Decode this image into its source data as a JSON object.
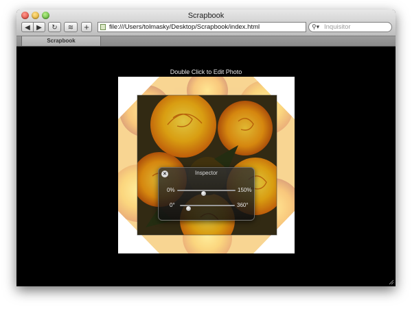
{
  "window": {
    "title": "Scrapbook",
    "traffic_lights": [
      "close",
      "minimize",
      "zoom"
    ]
  },
  "toolbar": {
    "back_icon": "◀",
    "forward_icon": "▶",
    "reload_icon": "↻",
    "snippet_icon": "≋",
    "add_icon": "+",
    "url": "file:///Users/tolmasky/Desktop/Scrapbook/index.html",
    "search_placeholder": "Inquisitor"
  },
  "tabs": [
    {
      "label": "Scrapbook"
    }
  ],
  "page": {
    "caption": "Double Click to Edit Photo",
    "photo_icon": "roses-photo",
    "inspector": {
      "title": "Inspector",
      "close_icon": "×",
      "sliders": [
        {
          "name": "opacity",
          "min_label": "0%",
          "max_label": "150%",
          "value_fraction": 0.45
        },
        {
          "name": "rotation",
          "min_label": "0°",
          "max_label": "360°",
          "value_fraction": 0.15
        }
      ]
    }
  },
  "colors": {
    "page_background": "#000000",
    "rose_yellow": "#f6c21a",
    "rose_orange": "#f08a16",
    "leaf_dark": "#2a3414"
  }
}
